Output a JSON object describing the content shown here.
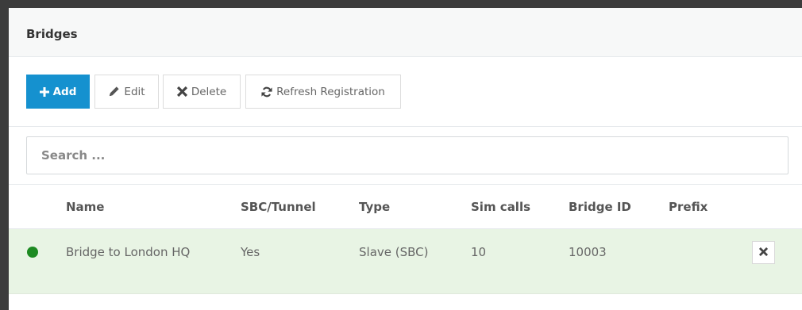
{
  "panel": {
    "title": "Bridges"
  },
  "toolbar": {
    "add_label": "Add",
    "edit_label": "Edit",
    "delete_label": "Delete",
    "refresh_label": "Refresh Registration"
  },
  "search": {
    "placeholder": "Search ..."
  },
  "table": {
    "headers": [
      "Name",
      "SBC/Tunnel",
      "Type",
      "Sim calls",
      "Bridge ID",
      "Prefix"
    ],
    "rows": [
      {
        "status": "online",
        "status_color": "#1d8a22",
        "name": "Bridge to London HQ",
        "sbc_tunnel": "Yes",
        "type": "Slave (SBC)",
        "sim_calls": "10",
        "bridge_id": "10003",
        "prefix": ""
      }
    ]
  },
  "icons": {
    "add": "plus-icon",
    "edit": "pencil-icon",
    "delete": "times-icon",
    "refresh": "refresh-icon",
    "row_remove": "times-icon"
  },
  "colors": {
    "accent": "#1591cf",
    "row_highlight": "#e8f4e4",
    "status_online": "#1d8a22"
  }
}
